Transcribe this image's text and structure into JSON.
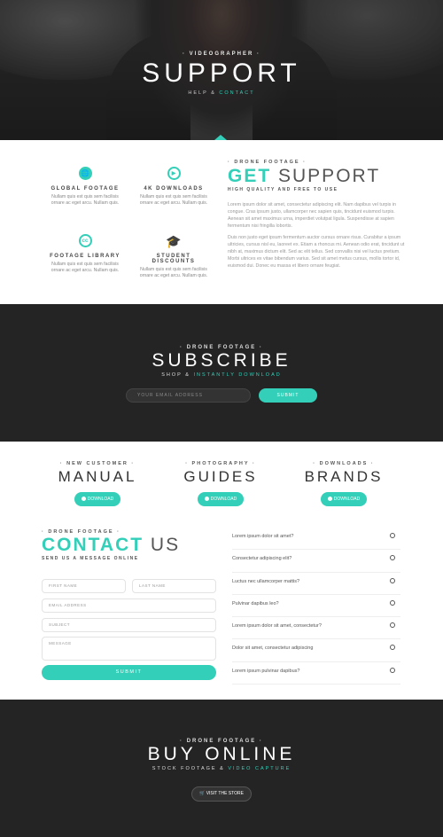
{
  "hero": {
    "eyebrow": "· VIDEOGRAPHER ·",
    "title": "SUPPORT",
    "sub_prefix": "HELP &",
    "sub_accent": "CONTACT"
  },
  "features": [
    {
      "icon": "globe-icon",
      "title": "GLOBAL FOOTAGE",
      "text": "Nullam quis est quis sem facilisis ornare ac eget arcu. Nullam quis."
    },
    {
      "icon": "play-icon",
      "title": "4K DOWNLOADS",
      "text": "Nullam quis est quis sem facilisis ornare ac eget arcu. Nullam quis."
    },
    {
      "icon": "creative-commons-icon",
      "title": "FOOTAGE LIBRARY",
      "text": "Nullam quis est quis sem facilisis ornare ac eget arcu. Nullam quis."
    },
    {
      "icon": "graduation-cap-icon",
      "title": "STUDENT DISCOUNTS",
      "text": "Nullam quis est quis sem facilisis ornare ac eget arcu. Nullam quis."
    }
  ],
  "get_support": {
    "eyebrow": "· DRONE FOOTAGE ·",
    "title_accent": "GET",
    "title_rest": " SUPPORT",
    "tagline": "HIGH QUALITY AND FREE TO USE",
    "p1": "Lorem ipsum dolor sit amet, consectetur adipiscing elit. Nam dapibus vel turpis in congue. Cras ipsum justo, ullamcorper nec sapien quis, tincidunt euismod turpis. Aenean sit amet maximus urna, imperdiet volutpat ligula. Suspendisse at sapien fermentum nisi fringilla lobortis.",
    "p2": "Duis non justo eget ipsum fermentum auctor cursus ornare risus. Curabitur a ipsum ultricies, cursus nisl eu, laoreet ex. Etiam a rhoncus mi. Aenean odio erat, tincidunt ut nibh at, maximus dictum elit. Sed ac elit tellus. Sed convallis nisi vel luctus pretium. Morbi ultrices ex vitae bibendum varius. Sed sit amet metus cursus, mollis tortor id, euismod dui. Donec eu massa et libero ornare feugiat."
  },
  "subscribe": {
    "eyebrow": "· DRONE FOOTAGE ·",
    "title": "SUBSCRIBE",
    "sub_prefix": "SHOP &",
    "sub_accent": "INSTANTLY DOWNLOAD",
    "email_placeholder": "YOUR EMAIL ADDRESS",
    "submit_label": "SUBMIT"
  },
  "downloads": [
    {
      "eyebrow": "· NEW CUSTOMER ·",
      "title": "MANUAL",
      "button": "DOWNLOAD"
    },
    {
      "eyebrow": "· PHOTOGRAPHY ·",
      "title": "GUIDES",
      "button": "DOWNLOAD"
    },
    {
      "eyebrow": "· DOWNLOADS ·",
      "title": "BRANDS",
      "button": "DOWNLOAD"
    }
  ],
  "contact": {
    "eyebrow": "· DRONE FOOTAGE ·",
    "title_accent": "CONTACT",
    "title_rest": " US",
    "tagline": "SEND US A MESSAGE ONLINE",
    "first_name": "FIRST NAME",
    "last_name": "LAST NAME",
    "email": "EMAIL ADDRESS",
    "subject": "SUBJECT",
    "message": "MESSAGE",
    "submit_label": "SUBMIT"
  },
  "faq": [
    "Lorem ipsum dolor sit amet?",
    "Consectetur adipiscing elit?",
    "Luctus nec ullamcorper mattis?",
    "Pulvinar dapibus leo?",
    "Lorem ipsum dolor sit amet, consectetur?",
    "Dolor sit amet, consectetur adipiscing",
    "Lorem ipsum pulvinar dapibus?"
  ],
  "buy": {
    "eyebrow": "· DRONE FOOTAGE ·",
    "title": "BUY ONLINE",
    "sub_prefix": "STOCK FOOTAGE &",
    "sub_accent": "VIDEO CAPTURE",
    "button": "VISIT THE STORE"
  },
  "colors": {
    "accent": "#33cfb8",
    "dark": "#242424"
  }
}
